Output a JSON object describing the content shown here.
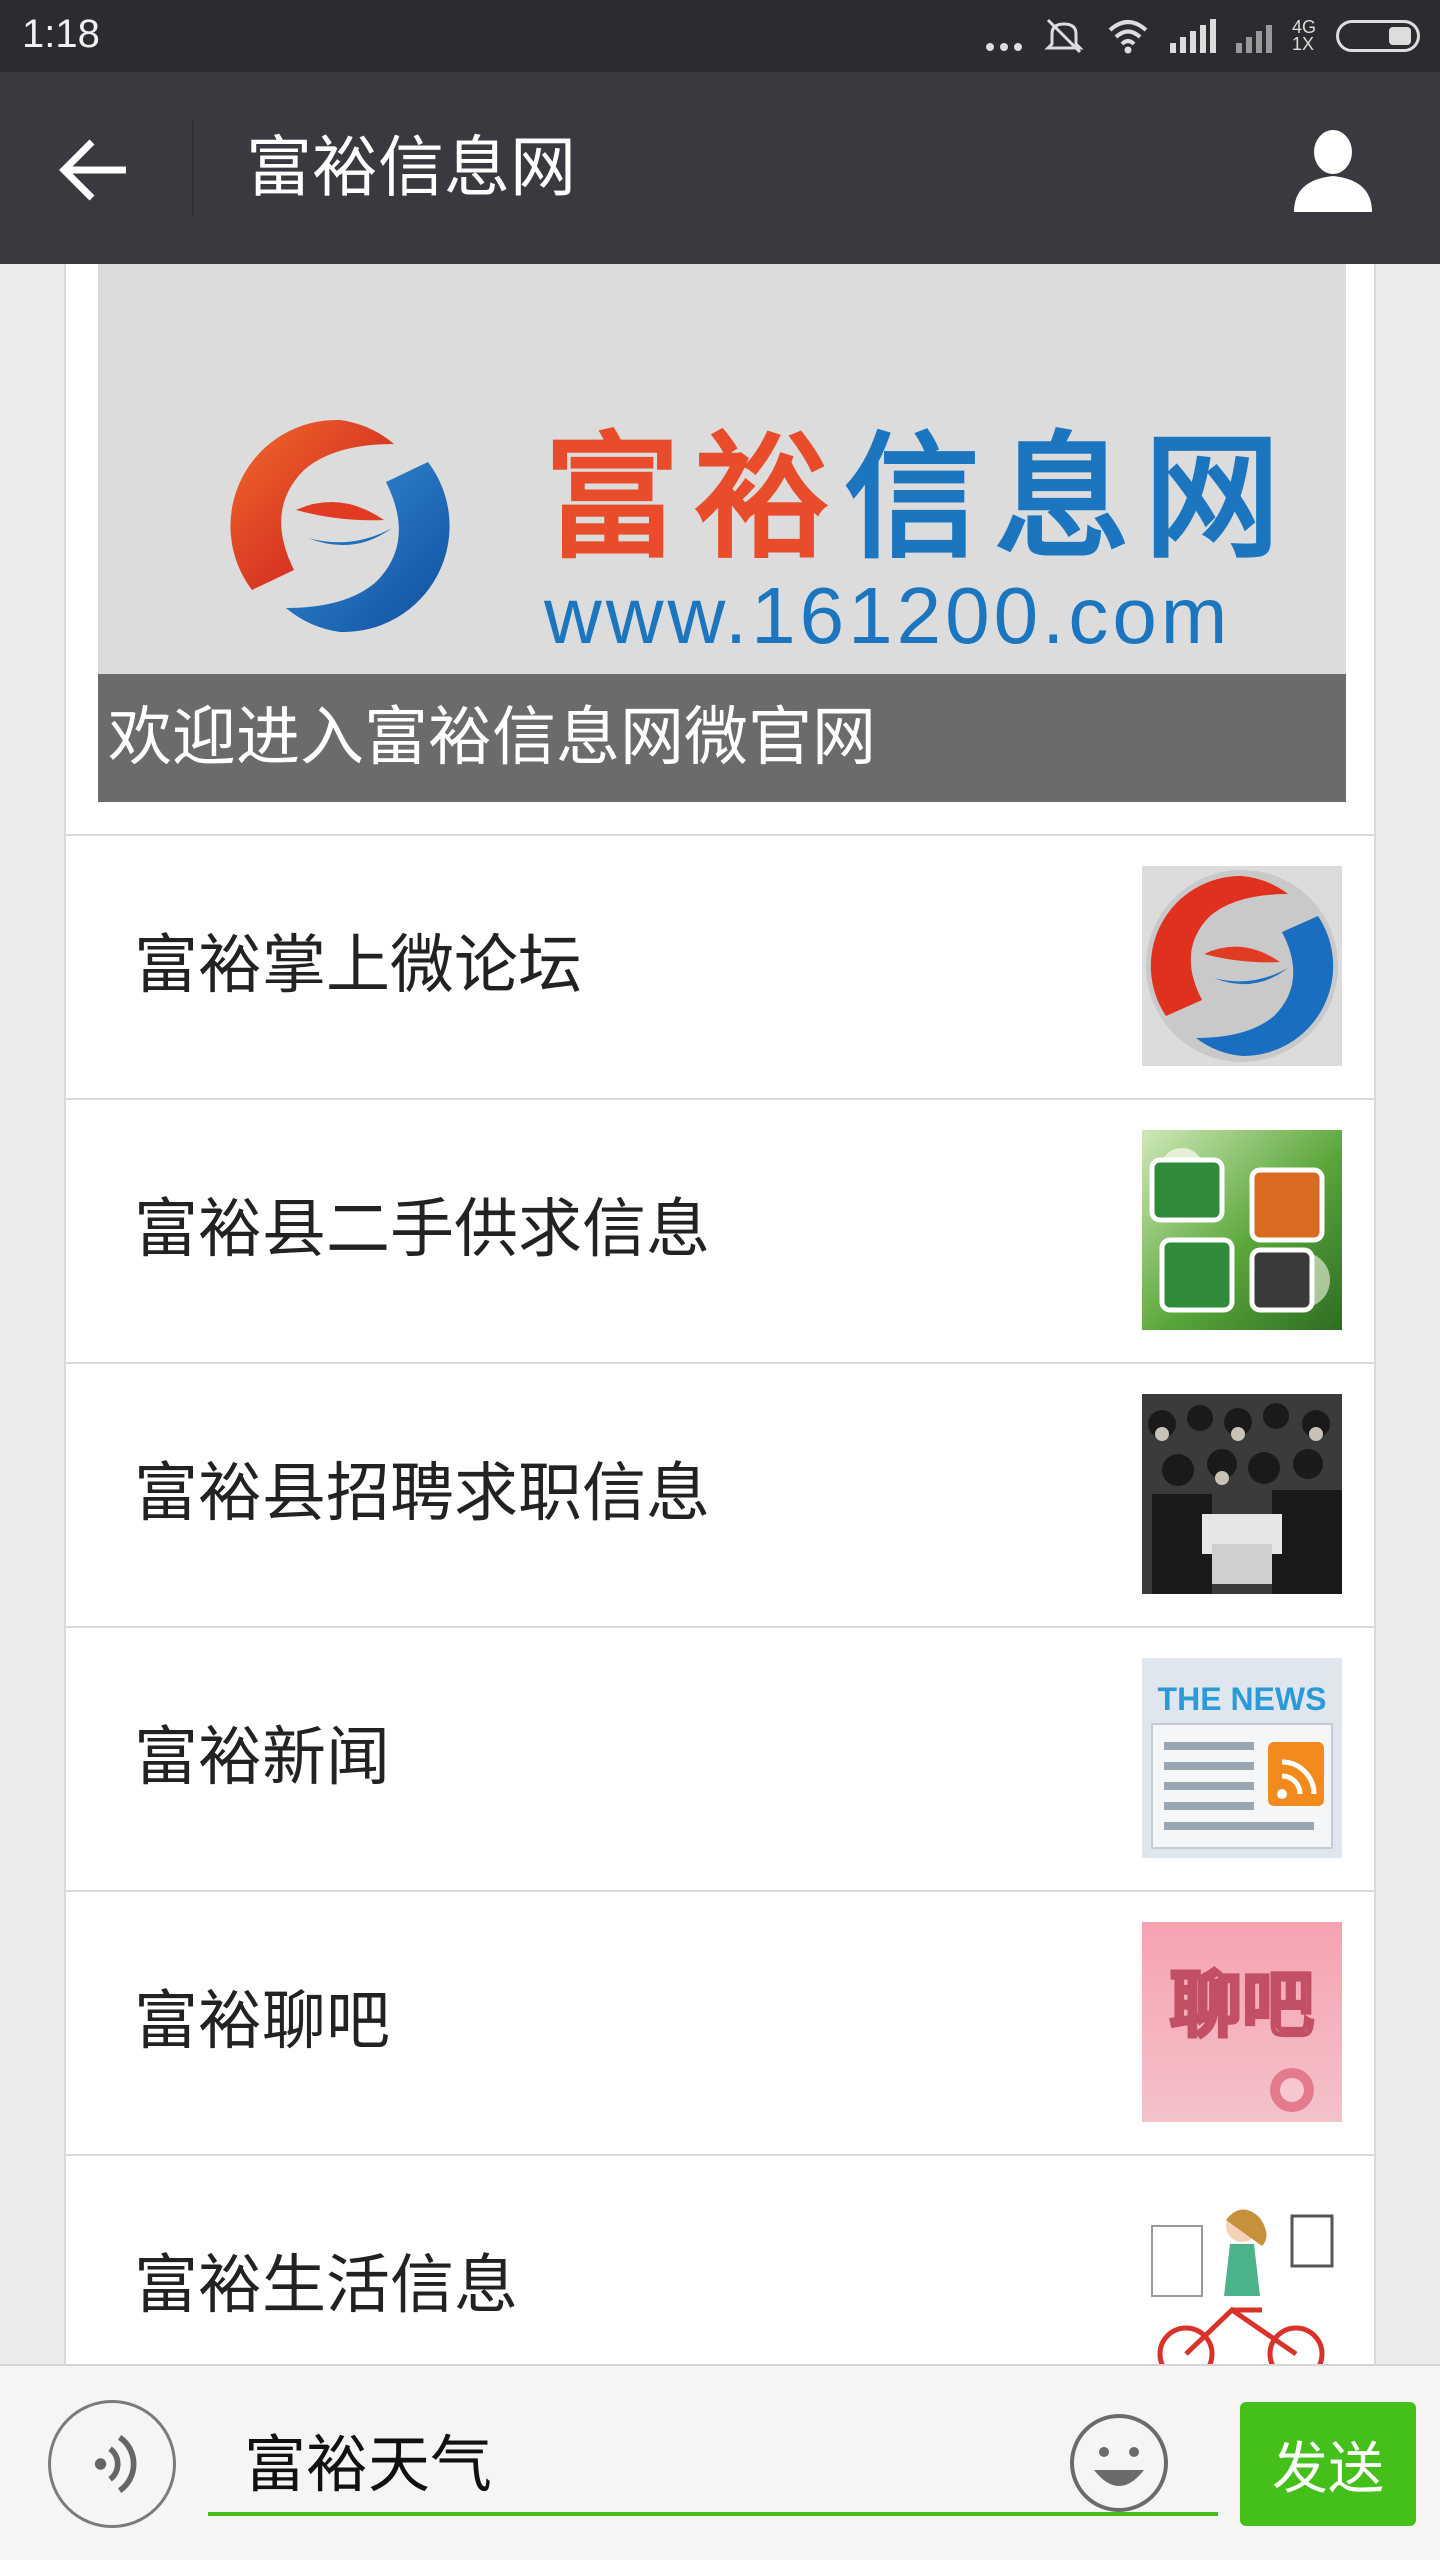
{
  "status_bar": {
    "time": "1:18",
    "network_label": "4G",
    "network_sub": "1X"
  },
  "header": {
    "title": "富裕信息网",
    "back_icon": "arrow-left-icon",
    "profile_icon": "person-icon"
  },
  "banner": {
    "brand_part1": "富裕",
    "brand_part2": "信息网",
    "url": "www.161200.com",
    "caption": "欢迎进入富裕信息网微官网"
  },
  "menu": {
    "items": [
      {
        "label": "富裕掌上微论坛",
        "thumb": "logo"
      },
      {
        "label": "富裕县二手供求信息",
        "thumb": "flea-market"
      },
      {
        "label": "富裕县招聘求职信息",
        "thumb": "job-fair-crowd"
      },
      {
        "label": "富裕新闻",
        "thumb": "the-news",
        "thumb_text": "THE NEWS"
      },
      {
        "label": "富裕聊吧",
        "thumb": "chat-bar",
        "thumb_text": "聊吧"
      },
      {
        "label": "富裕生活信息",
        "thumb": "girl-on-bicycle"
      }
    ]
  },
  "input_bar": {
    "value": "富裕天气",
    "send_label": "发送",
    "voice_icon": "voice-icon",
    "emoji_icon": "emoji-icon"
  },
  "colors": {
    "accent_green": "#45c01a",
    "titlebar": "#393a3f",
    "statusbar": "#2b2c2f",
    "brand_red": "#e84c2a",
    "brand_blue": "#1b76bf"
  }
}
